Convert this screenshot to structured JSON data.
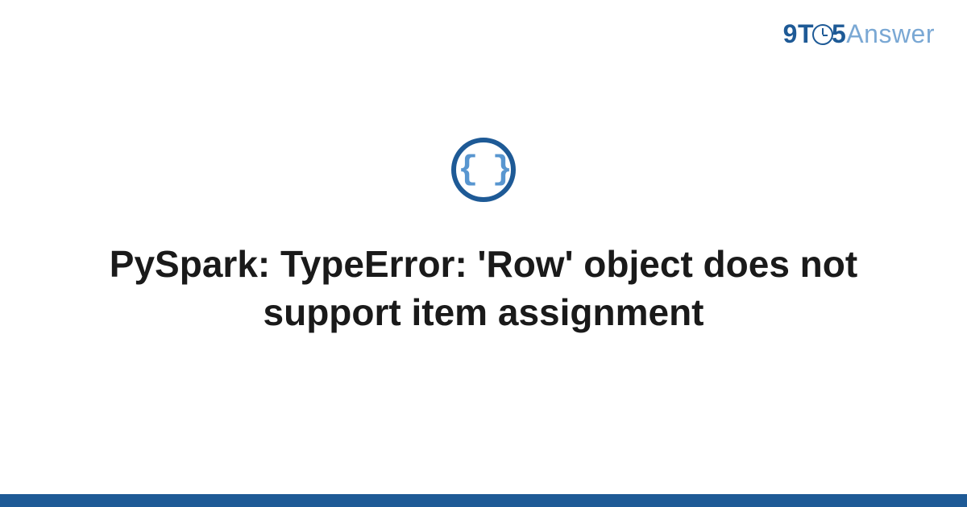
{
  "logo": {
    "prefix": "9T",
    "middle": "5",
    "suffix": "Answer"
  },
  "icon": {
    "glyph": "{ }"
  },
  "title": "PySpark: TypeError: 'Row' object does not support item assignment"
}
